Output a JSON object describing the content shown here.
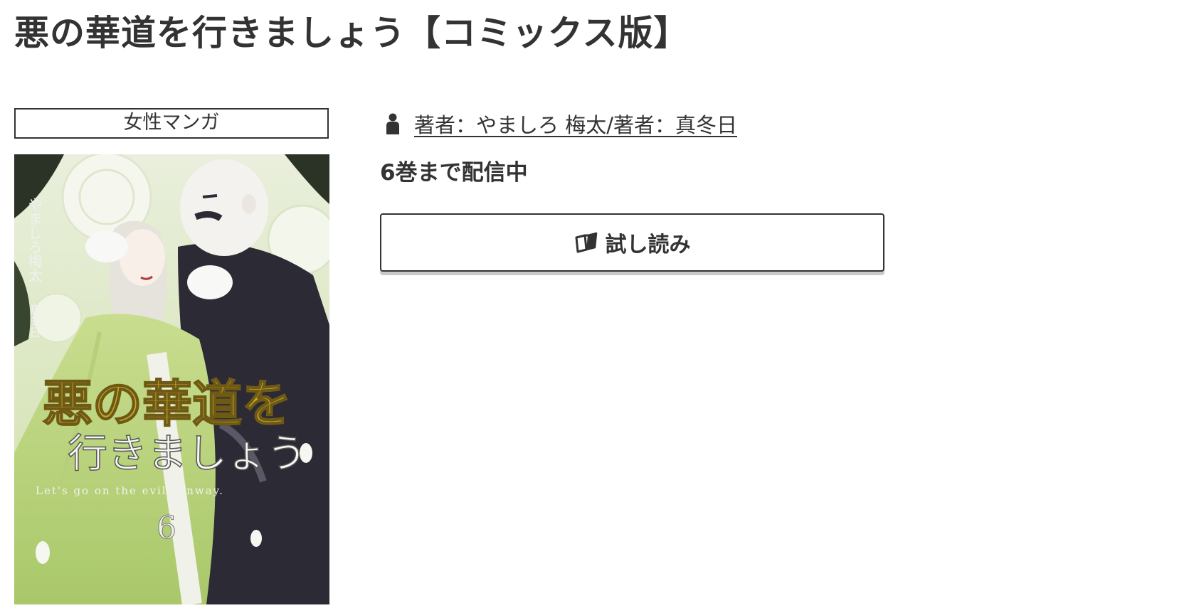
{
  "page": {
    "title": "悪の華道を行きましょう【コミックス版】"
  },
  "genre": {
    "label": "女性マンガ"
  },
  "cover": {
    "title_line1": "悪の華道を",
    "title_line2": "行きましょう",
    "subtitle": "Let's go on the evil runway.",
    "volume": "6",
    "author_vertical": "やましろ梅太",
    "author_vertical_2": "真冬日"
  },
  "author": {
    "icon": "person-icon",
    "text": "著者：やましろ 梅太/著者：真冬日"
  },
  "status": {
    "text": "6巻まで配信中"
  },
  "trial_button": {
    "icon": "book-icon",
    "label": "試し読み"
  },
  "colors": {
    "text": "#333333",
    "border": "#333333",
    "button_shadow": "#c9c9c9",
    "background": "#ffffff",
    "cover_title_gold": "#c9a92c"
  }
}
